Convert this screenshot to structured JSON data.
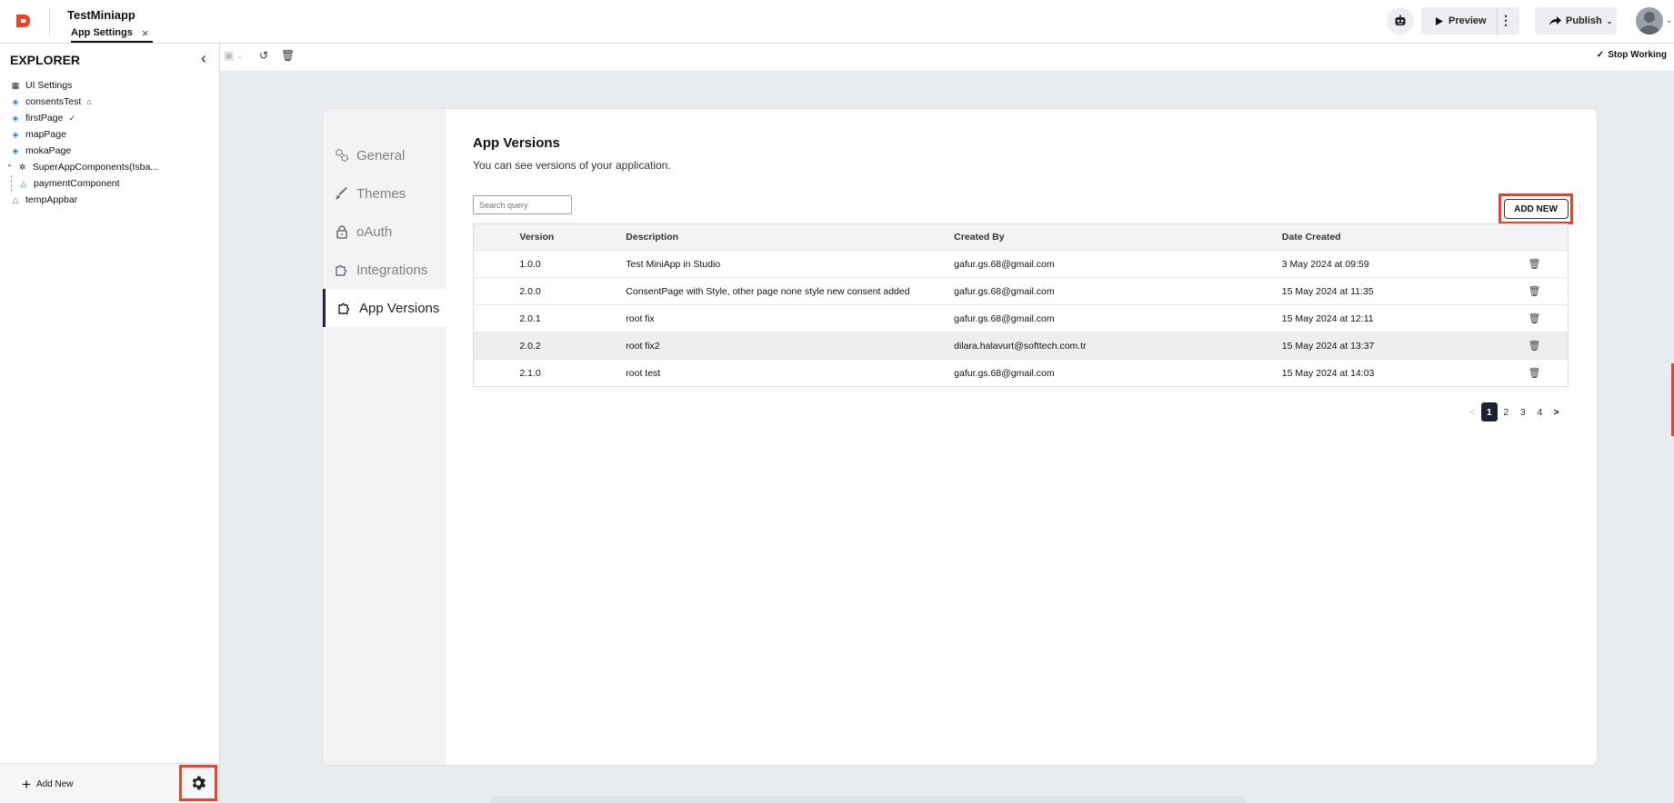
{
  "header": {
    "app_title": "TestMiniapp",
    "tab_label": "App Settings",
    "tab_close": "×",
    "preview_label": "Preview",
    "publish_label": "Publish"
  },
  "sidebar": {
    "title": "EXPLORER",
    "items": [
      {
        "label": "UI Settings",
        "icon": "ui-settings-icon"
      },
      {
        "label": "consentsTest",
        "icon": "page-icon",
        "badge": "home-icon"
      },
      {
        "label": "firstPage",
        "icon": "page-icon",
        "badge": "check-circle-icon"
      },
      {
        "label": "mapPage",
        "icon": "page-icon"
      },
      {
        "label": "mokaPage",
        "icon": "page-icon"
      },
      {
        "label": "SuperAppComponents(Isba...",
        "icon": "puzzle-icon"
      },
      {
        "label": "paymentComponent",
        "icon": "component-icon"
      },
      {
        "label": "tempAppbar",
        "icon": "component-icon"
      }
    ],
    "add_new_label": "Add New"
  },
  "toolbar": {
    "stop_working_label": "Stop Working"
  },
  "settings_nav": {
    "items": [
      {
        "label": "General",
        "icon": "gears-icon"
      },
      {
        "label": "Themes",
        "icon": "brush-icon"
      },
      {
        "label": "oAuth",
        "icon": "lock-icon"
      },
      {
        "label": "Integrations",
        "icon": "puzzle-icon"
      },
      {
        "label": "App Versions",
        "icon": "puzzle-icon",
        "active": true
      }
    ]
  },
  "versions": {
    "title": "App Versions",
    "subtitle": "You can see versions of your application.",
    "search_placeholder": "Search query",
    "add_new_label": "ADD NEW",
    "columns": [
      "Version",
      "Description",
      "Created By",
      "Date Created"
    ],
    "rows": [
      {
        "version": "1.0.0",
        "description": "Test MiniApp in Studio",
        "created_by": "gafur.gs.68@gmail.com",
        "date": "3 May 2024 at 09:59"
      },
      {
        "version": "2.0.0",
        "description": "ConsentPage with Style, other page none style new consent added",
        "created_by": "gafur.gs.68@gmail.com",
        "date": "15 May 2024 at 11:35"
      },
      {
        "version": "2.0.1",
        "description": "root fix",
        "created_by": "gafur.gs.68@gmail.com",
        "date": "15 May 2024 at 12:11"
      },
      {
        "version": "2.0.2",
        "description": "root fix2",
        "created_by": "dilara.halavurt@softtech.com.tr",
        "date": "15 May 2024 at 13:37"
      },
      {
        "version": "2.1.0",
        "description": "root test",
        "created_by": "gafur.gs.68@gmail.com",
        "date": "15 May 2024 at 14:03"
      }
    ],
    "pagination": {
      "prev": "<",
      "pages": [
        "1",
        "2",
        "3",
        "4"
      ],
      "current": "1",
      "next": ">"
    }
  },
  "colors": {
    "highlight": "#e8432d",
    "brand": "#e8432d",
    "active_page": "#1c2230"
  }
}
